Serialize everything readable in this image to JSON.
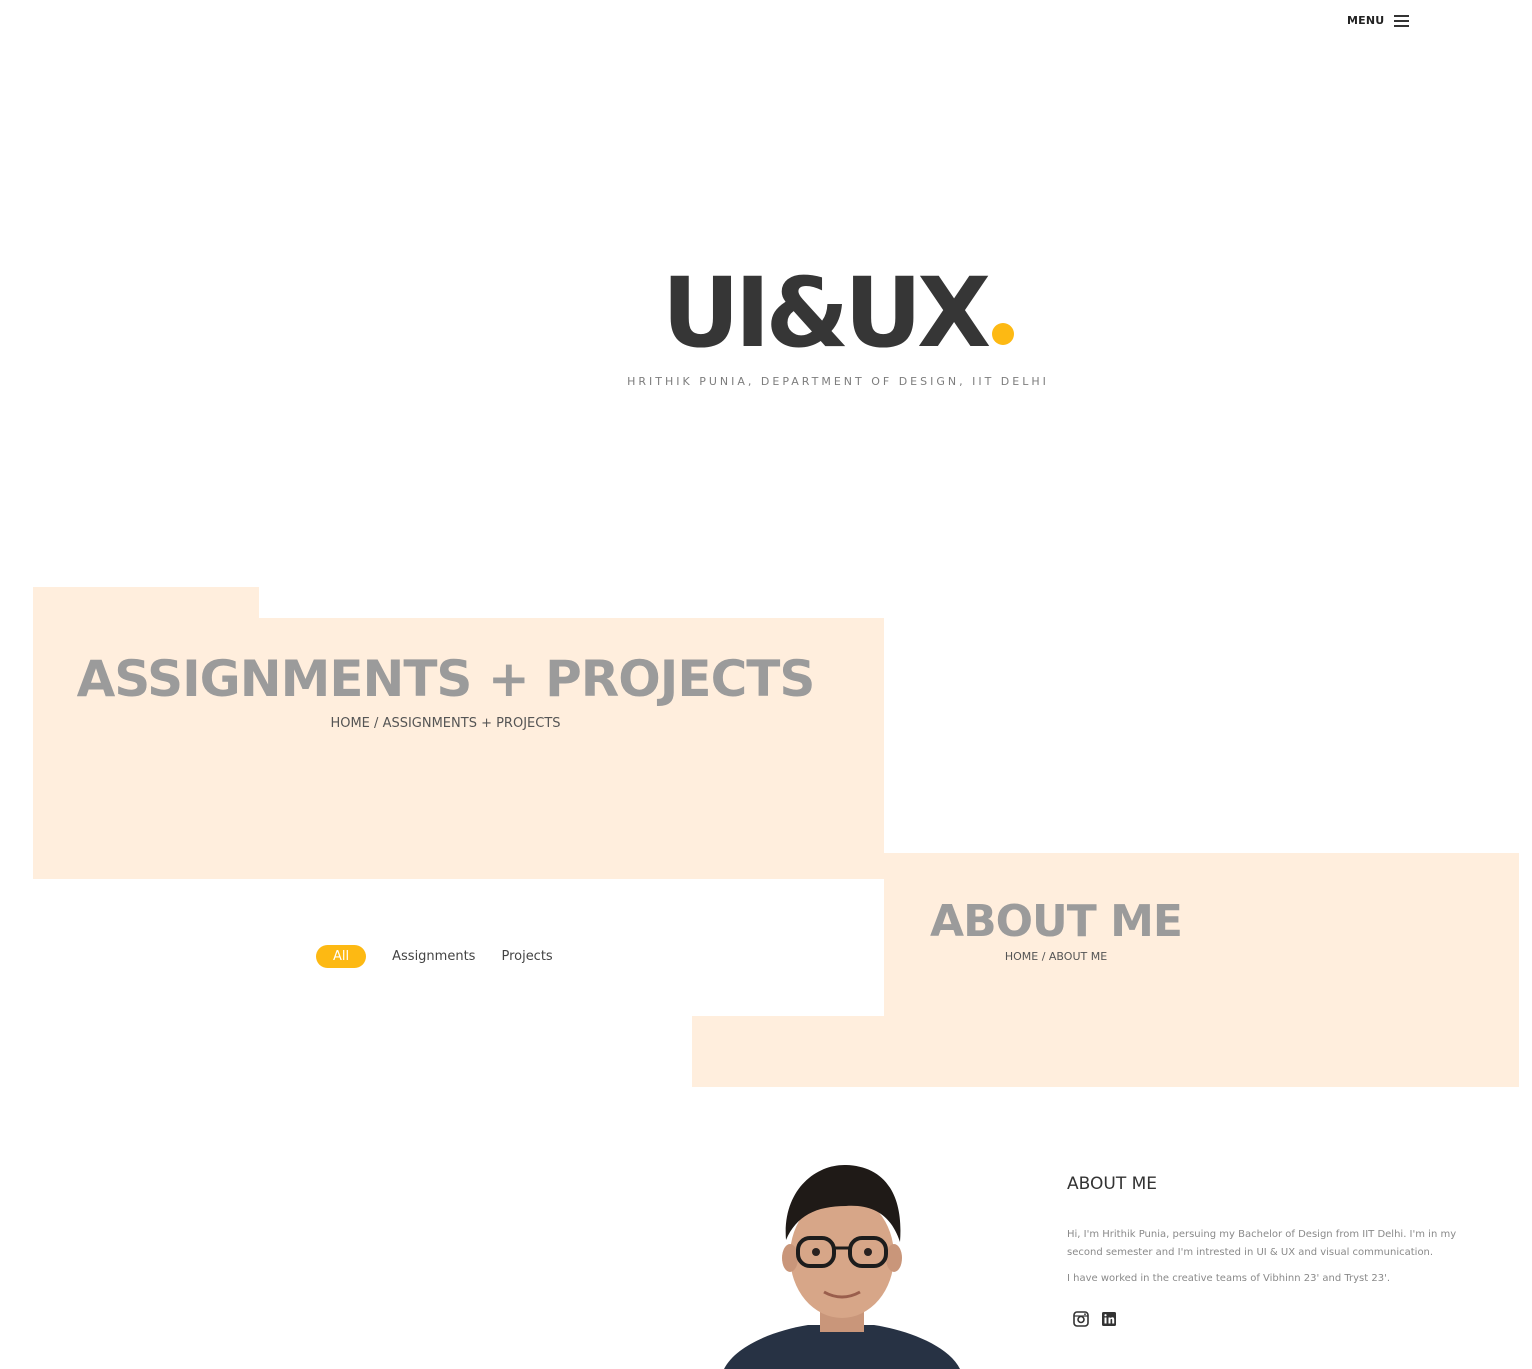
{
  "header": {
    "menu_label": "MENU",
    "menu_icon": "hamburger-icon"
  },
  "hero": {
    "title": "UI&UX",
    "accent_color": "#fdb913",
    "subtitle": "HRITHIK PUNIA, DEPARTMENT OF DESIGN, IIT DELHI"
  },
  "assignments_section": {
    "title": "ASSIGNMENTS + PROJECTS",
    "breadcrumb_home": "HOME",
    "breadcrumb_separator": " / ",
    "breadcrumb_current": "ASSIGNMENTS + PROJECTS",
    "panel_color": "#ffeedd",
    "filters": [
      {
        "label": "All",
        "active": true
      },
      {
        "label": "Assignments",
        "active": false
      },
      {
        "label": "Projects",
        "active": false
      }
    ]
  },
  "about_section": {
    "title": "ABOUT ME",
    "breadcrumb_home": "HOME",
    "breadcrumb_separator": " / ",
    "breadcrumb_current": "ABOUT ME",
    "heading": "ABOUT ME",
    "paragraphs": [
      "Hi, I'm Hrithik Punia, persuing my Bachelor of Design from IIT Delhi. I'm in my second semester and I'm intrested in UI & UX and visual communication.",
      "I have worked in the creative teams of Vibhinn 23' and Tryst 23'."
    ],
    "social_icons": [
      "instagram-icon",
      "linkedin-icon"
    ]
  }
}
